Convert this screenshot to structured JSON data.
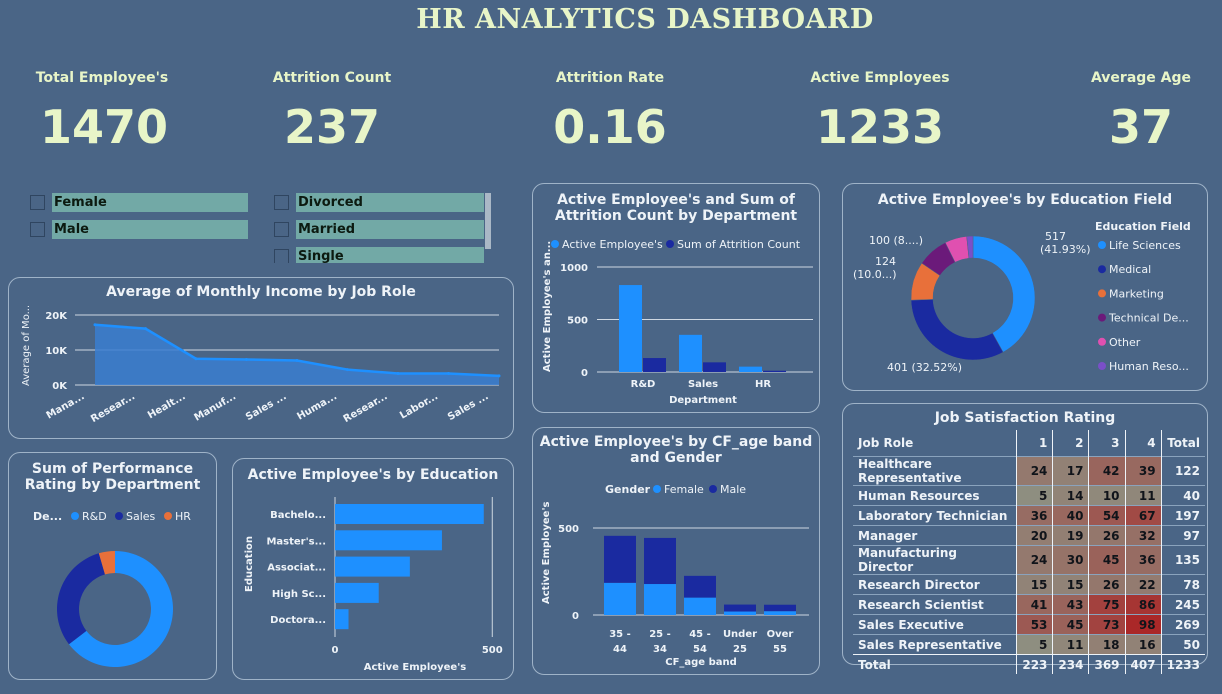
{
  "dashboard_title": "HR ANALYTICS DASHBOARD",
  "kpis": [
    {
      "label": "Total Employee's",
      "value": "1470"
    },
    {
      "label": "Attrition Count",
      "value": "237"
    },
    {
      "label": "Attrition Rate",
      "value": "0.16"
    },
    {
      "label": "Active Employees",
      "value": "1233"
    },
    {
      "label": "Average Age",
      "value": "37"
    }
  ],
  "slicers": {
    "gender": [
      "Female",
      "Male"
    ],
    "marital": [
      "Divorced",
      "Married",
      "Single"
    ]
  },
  "income_chart": {
    "title": "Average of Monthly Income by Job Role",
    "ylabel": "Average of Mo...",
    "yticks": [
      "20K",
      "10K",
      "0K"
    ],
    "xlabels": [
      "Mana...",
      "Resear...",
      "Healt...",
      "Manuf...",
      "Sales ...",
      "Huma...",
      "Resear...",
      "Labor...",
      "Sales ..."
    ]
  },
  "dept_chart": {
    "title_line1": "Active Employee's and Sum of",
    "title_line2": "Attrition Count by Department",
    "legend_active": "Active Employee's",
    "legend_attr": "Sum of Attrition Count",
    "ylabel": "Active Employee's an...",
    "xlabel": "Department",
    "yticks": [
      "1000",
      "500",
      "0"
    ]
  },
  "edu_field_chart": {
    "title": "Active Employee's by Education Field",
    "legend_title": "Education Field",
    "legend": [
      "Life Sciences",
      "Medical",
      "Marketing",
      "Technical De...",
      "Other",
      "Human Reso..."
    ],
    "labels": {
      "ls": "517",
      "ls_pct": "(41.93%)",
      "med": "401 (32.52%)",
      "mkt": "124",
      "mkt_pct": "(10.0...)",
      "other": "100 (8....)"
    }
  },
  "perf_chart": {
    "title_line1": "Sum of Performance",
    "title_line2": "Rating by Department",
    "legend_title": "De...",
    "legend": [
      "R&D",
      "Sales",
      "HR"
    ]
  },
  "education_chart": {
    "title": "Active Employee's by Education",
    "ylabel": "Education",
    "xlabel": "Active Employee's",
    "xticks": [
      "0",
      "500"
    ]
  },
  "age_chart": {
    "title_line1": "Active Employee's by CF_age band",
    "title_line2": "and Gender",
    "legend_title": "Gender",
    "legend": [
      "Female",
      "Male"
    ],
    "ylabel": "Active Employee's",
    "xlabel": "CF_age band",
    "yticks": [
      "500",
      "0"
    ]
  },
  "job_satisfaction": {
    "title": "Job Satisfaction Rating",
    "columns": [
      "Job Role",
      "1",
      "2",
      "3",
      "4",
      "Total"
    ],
    "rows": [
      [
        "Healthcare Representative",
        "24",
        "17",
        "42",
        "39",
        "122"
      ],
      [
        "Human Resources",
        "5",
        "14",
        "10",
        "11",
        "40"
      ],
      [
        "Laboratory Technician",
        "36",
        "40",
        "54",
        "67",
        "197"
      ],
      [
        "Manager",
        "20",
        "19",
        "26",
        "32",
        "97"
      ],
      [
        "Manufacturing Director",
        "24",
        "30",
        "45",
        "36",
        "135"
      ],
      [
        "Research Director",
        "15",
        "15",
        "26",
        "22",
        "78"
      ],
      [
        "Research Scientist",
        "41",
        "43",
        "75",
        "86",
        "245"
      ],
      [
        "Sales Executive",
        "53",
        "45",
        "73",
        "98",
        "269"
      ],
      [
        "Sales Representative",
        "5",
        "11",
        "18",
        "16",
        "50"
      ]
    ],
    "total": [
      "Total",
      "223",
      "234",
      "369",
      "407",
      "1233"
    ]
  },
  "chart_data": [
    {
      "type": "area",
      "title": "Average of Monthly Income by Job Role",
      "categories": [
        "Mana...",
        "Resear...",
        "Healt...",
        "Manuf...",
        "Sales ...",
        "Huma...",
        "Resear...",
        "Labor...",
        "Sales ..."
      ],
      "values": [
        17200,
        16100,
        7500,
        7300,
        7000,
        4400,
        3300,
        3300,
        2600
      ],
      "ylim": [
        0,
        20000
      ]
    },
    {
      "type": "bar",
      "title": "Active Employee's and Sum of Attrition Count by Department",
      "categories": [
        "R&D",
        "Sales",
        "HR"
      ],
      "series": [
        {
          "name": "Active Employee's",
          "values": [
            828,
            354,
            51
          ]
        },
        {
          "name": "Sum of Attrition Count",
          "values": [
            133,
            92,
            12
          ]
        }
      ],
      "ylim": [
        0,
        1000
      ]
    },
    {
      "type": "pie",
      "title": "Active Employee's by Education Field",
      "categories": [
        "Life Sciences",
        "Medical",
        "Marketing",
        "Technical De...",
        "Other",
        "Human Reso..."
      ],
      "values": [
        517,
        401,
        124,
        100,
        71,
        20
      ]
    },
    {
      "type": "pie",
      "title": "Sum of Performance Rating by Department",
      "categories": [
        "R&D",
        "Sales",
        "HR"
      ],
      "values": [
        64.6,
        30.9,
        4.5
      ]
    },
    {
      "type": "bar",
      "title": "Active Employee's by Education",
      "categories": [
        "Bachelo...",
        "Master's...",
        "Associat...",
        "High Sc...",
        "Doctora..."
      ],
      "values": [
        473,
        340,
        238,
        139,
        43
      ],
      "xlim": [
        0,
        550
      ]
    },
    {
      "type": "bar",
      "title": "Active Employee's by CF_age band and Gender",
      "categories": [
        "35 - 44",
        "25 - 34",
        "45 - 54",
        "Under 25",
        "Over 55"
      ],
      "series": [
        {
          "name": "Female",
          "values": [
            185,
            178,
            100,
            20,
            22
          ]
        },
        {
          "name": "Male",
          "values": [
            270,
            265,
            125,
            40,
            37
          ]
        }
      ],
      "ylim": [
        0,
        560
      ]
    }
  ]
}
